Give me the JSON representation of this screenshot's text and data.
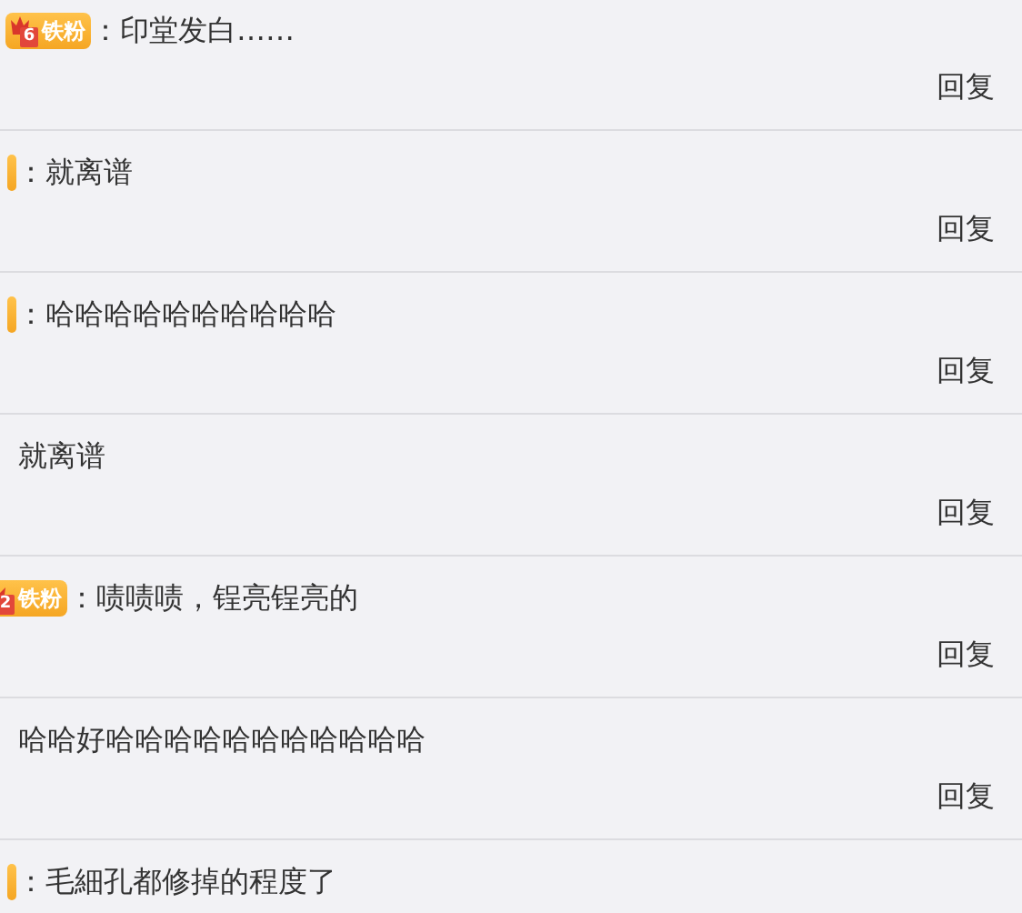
{
  "comments": [
    {
      "badge": {
        "kind": "full",
        "level": "6",
        "label": "铁粉"
      },
      "text": "：印堂发白……",
      "reply": "回复"
    },
    {
      "badge": {
        "kind": "sliver"
      },
      "text": "：就离谱",
      "reply": "回复"
    },
    {
      "badge": {
        "kind": "sliver"
      },
      "text": "：哈哈哈哈哈哈哈哈哈哈",
      "reply": "回复"
    },
    {
      "text": "就离谱",
      "reply": "回复"
    },
    {
      "badge": {
        "kind": "partial",
        "level": "2",
        "label": "铁粉"
      },
      "text": "：啧啧啧，锃亮锃亮的",
      "reply": "回复"
    },
    {
      "text": "哈哈好哈哈哈哈哈哈哈哈哈哈哈",
      "reply": "回复"
    },
    {
      "badge": {
        "kind": "sliver"
      },
      "text": "：毛細孔都修掉的程度了"
    }
  ]
}
